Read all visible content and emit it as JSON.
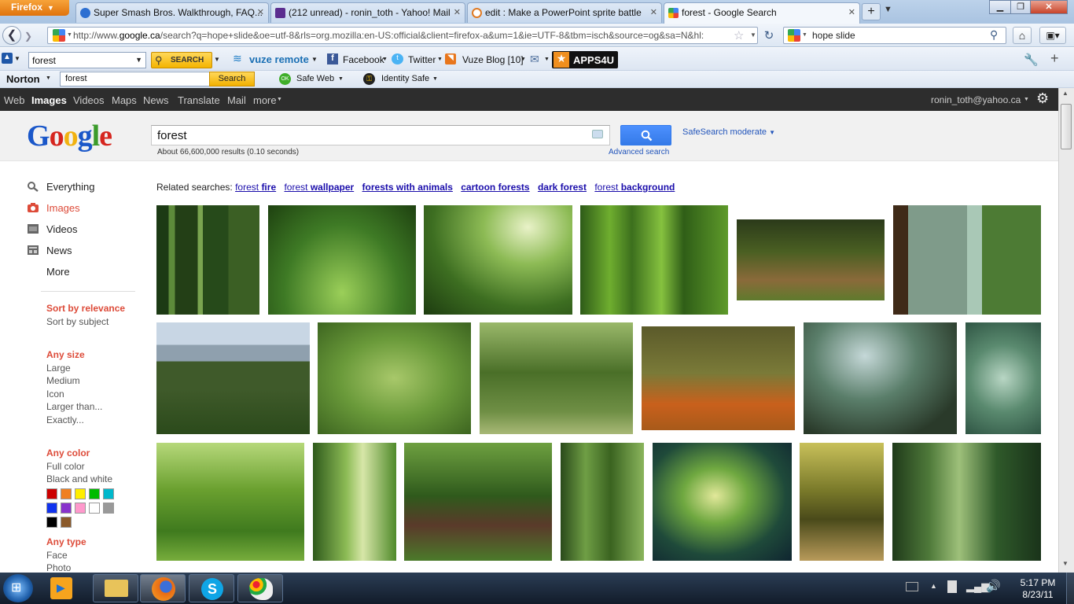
{
  "browser": {
    "app_button": "Firefox",
    "tabs": [
      {
        "title": "Super Smash Bros. Walkthrough, FAQ...",
        "fav": "#2d6fd1"
      },
      {
        "title": "(212 unread) - ronin_toth - Yahoo! Mail",
        "fav": "#5b2d8f"
      },
      {
        "title": "edit : Make a PowerPoint sprite battle",
        "fav": "#e07b24"
      },
      {
        "title": "forest - Google Search",
        "fav": "#4285f4"
      }
    ],
    "url_prefix": "http://www.",
    "url_domain": "google.ca",
    "url_rest": "/search?q=hope+slide&oe=utf-8&rls=org.mozilla:en-US:official&client=firefox-a&um=1&ie=UTF-8&tbm=isch&source=og&sa=N&hl:",
    "search_engine_query": "hope slide"
  },
  "toolbar1": {
    "query": "forest",
    "search_label": "SEARCH",
    "vuze": "vuze remote",
    "facebook": "Facebook",
    "twitter": "Twitter",
    "vuze_blog": "Vuze Blog [10]",
    "apps": "APPS4U"
  },
  "toolbar2": {
    "norton": "Norton",
    "query": "forest",
    "search_label": "Search",
    "safe_web": "Safe Web",
    "identity_safe": "Identity Safe"
  },
  "gbar": {
    "links": [
      "Web",
      "Images",
      "Videos",
      "Maps",
      "News",
      "Translate",
      "Mail",
      "more"
    ],
    "user": "ronin_toth@yahoo.ca"
  },
  "header": {
    "logo": [
      "G",
      "o",
      "o",
      "g",
      "l",
      "e"
    ],
    "query": "forest",
    "results": "About 66,600,000 results (0.10 seconds)",
    "advanced": "Advanced search",
    "safesearch": "SafeSearch moderate"
  },
  "leftnav": {
    "items": [
      "Everything",
      "Images",
      "Videos",
      "News",
      "More"
    ],
    "sort_head": "Sort by relevance",
    "sort_opt": "Sort by subject",
    "size_head": "Any size",
    "sizes": [
      "Large",
      "Medium",
      "Icon",
      "Larger than...",
      "Exactly..."
    ],
    "color_head": "Any color",
    "colors_opts": [
      "Full color",
      "Black and white"
    ],
    "swatches": [
      "#cc0000",
      "#f08020",
      "#ffee00",
      "#00bb00",
      "#00b8cc",
      "#1133ee",
      "#8833cc",
      "#ff99cc",
      "#ffffff",
      "#999999",
      "#000000",
      "#8b5a2b"
    ],
    "type_head": "Any type",
    "types": [
      "Face",
      "Photo"
    ]
  },
  "related": {
    "label": "Related searches:",
    "links": [
      {
        "pre": "forest ",
        "b": "fire"
      },
      {
        "pre": "forest ",
        "b": "wallpaper"
      },
      {
        "pre": "",
        "b": "forests with animals"
      },
      {
        "pre": "",
        "b": "cartoon forests"
      },
      {
        "pre": "",
        "b": "dark forest"
      },
      {
        "pre": "forest ",
        "b": "background"
      }
    ]
  },
  "taskbar": {
    "time": "5:17 PM",
    "date": "8/23/11"
  }
}
